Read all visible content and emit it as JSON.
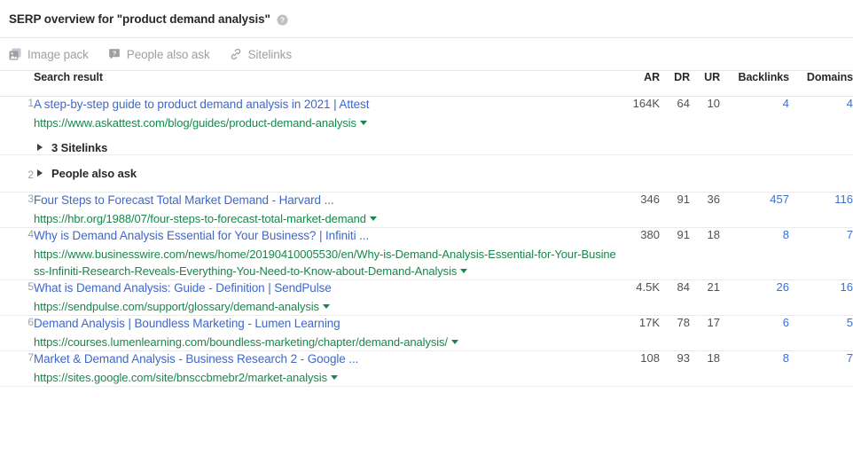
{
  "panel": {
    "title": "SERP overview for \"product demand analysis\"",
    "help_icon": "question-mark-circle-icon"
  },
  "serp_features": [
    {
      "icon": "image-pack-icon",
      "label": "Image pack"
    },
    {
      "icon": "people-also-ask-icon",
      "label": "People also ask"
    },
    {
      "icon": "sitelinks-link-icon",
      "label": "Sitelinks"
    }
  ],
  "table": {
    "headers": {
      "result": "Search result",
      "ar": "AR",
      "dr": "DR",
      "ur": "UR",
      "backlinks": "Backlinks",
      "domains": "Domains"
    },
    "rows": [
      {
        "num": "1",
        "type": "result",
        "title": "A step-by-step guide to product demand analysis in 2021 | Attest",
        "url": "https://www.askattest.com/blog/guides/product-demand-analysis",
        "expander": "3 Sitelinks",
        "ar": "164K",
        "dr": "64",
        "ur": "10",
        "backlinks": "4",
        "domains": "4"
      },
      {
        "num": "2",
        "type": "feature",
        "expander": "People also ask",
        "ar": "",
        "dr": "",
        "ur": "",
        "backlinks": "",
        "domains": ""
      },
      {
        "num": "3",
        "type": "result",
        "title": "Four Steps to Forecast Total Market Demand - Harvard ...",
        "url": "https://hbr.org/1988/07/four-steps-to-forecast-total-market-demand",
        "ar": "346",
        "dr": "91",
        "ur": "36",
        "backlinks": "457",
        "domains": "116"
      },
      {
        "num": "4",
        "type": "result",
        "title": "Why is Demand Analysis Essential for Your Business? | Infiniti ...",
        "url": "https://www.businesswire.com/news/home/20190410005530/en/Why-is-Demand-Analysis-Essential-for-Your-Business-Infiniti-Research-Reveals-Everything-You-Need-to-Know-about-Demand-Analysis",
        "ar": "380",
        "dr": "91",
        "ur": "18",
        "backlinks": "8",
        "domains": "7"
      },
      {
        "num": "5",
        "type": "result",
        "title": "What is Demand Analysis: Guide - Definition | SendPulse",
        "url": "https://sendpulse.com/support/glossary/demand-analysis",
        "ar": "4.5K",
        "dr": "84",
        "ur": "21",
        "backlinks": "26",
        "domains": "16"
      },
      {
        "num": "6",
        "type": "result",
        "title": "Demand Analysis | Boundless Marketing - Lumen Learning",
        "url": "https://courses.lumenlearning.com/boundless-marketing/chapter/demand-analysis/",
        "ar": "17K",
        "dr": "78",
        "ur": "17",
        "backlinks": "6",
        "domains": "5"
      },
      {
        "num": "7",
        "type": "result",
        "title": "Market & Demand Analysis - Business Research 2 - Google ...",
        "url": "https://sites.google.com/site/bnsccbmebr2/market-analysis",
        "ar": "108",
        "dr": "93",
        "ur": "18",
        "backlinks": "8",
        "domains": "7"
      }
    ]
  },
  "colors": {
    "title_link": "#3f68c8",
    "url_green": "#18874b",
    "metric_link": "#3a6fd8",
    "muted": "#9aa0a6",
    "border": "#e6e8ea"
  }
}
